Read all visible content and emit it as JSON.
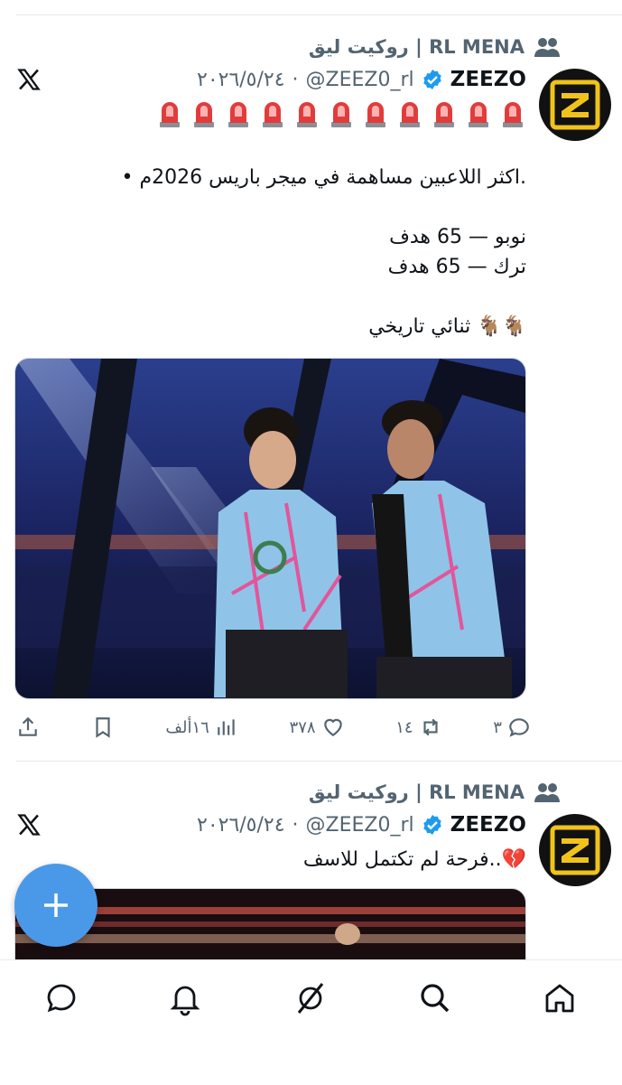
{
  "tweets": [
    {
      "context": "RL MENA | روكيت ليق",
      "author_name": "ZEEZO",
      "handle": "@ZEEZ0_rl",
      "date": "٢٠٢٦/٥/٢٤",
      "sirens": "🚨🚨🚨🚨🚨🚨🚨🚨🚨🚨🚨",
      "text": ".اكثر اللاعبين مساهمة في ميجر باريس 2026م •\n\nنوبو — 65 هدف\nترك — 65 هدف\n\n🐐🐐 ثنائي تاريخي",
      "stats": {
        "replies": "٣",
        "reposts": "١٤",
        "likes": "٣٧٨",
        "views": "١٦ألف"
      }
    },
    {
      "context": "RL MENA | روكيت ليق",
      "author_name": "ZEEZO",
      "handle": "@ZEEZ0_rl",
      "date": "٢٠٢٦/٥/٢٤",
      "text": "💔..فرحة لم تكتمل للاسف"
    }
  ],
  "icons": {
    "context": "people-icon",
    "verified": "verified-badge-icon",
    "x": "x-logo-icon",
    "reply": "reply-icon",
    "repost": "repost-icon",
    "like": "heart-icon",
    "views": "views-icon",
    "bookmark": "bookmark-icon",
    "share": "share-icon",
    "compose": "plus-icon"
  },
  "nav": [
    "chat-icon",
    "bell-icon",
    "grok-icon",
    "search-icon",
    "home-icon"
  ],
  "colors": {
    "accent": "#4a99e9",
    "verified": "#1d9bf0",
    "muted": "#536471",
    "logo": "#f0c31a"
  }
}
